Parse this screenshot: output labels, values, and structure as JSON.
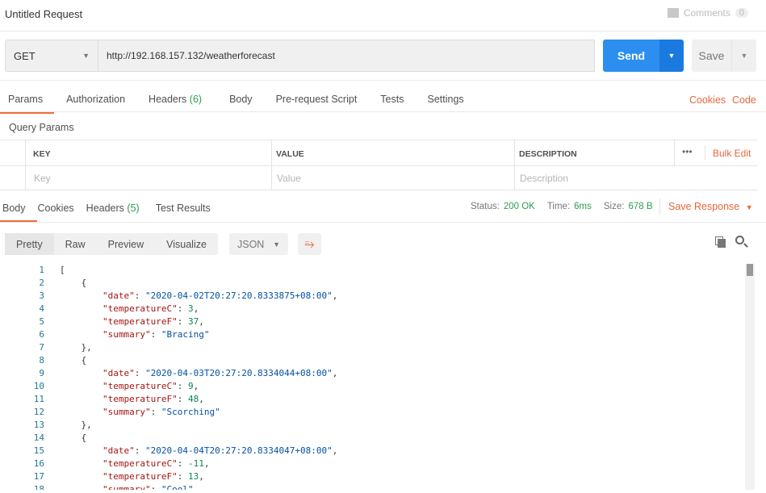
{
  "title": "Untitled Request",
  "comments": {
    "label": "Comments",
    "count": "0"
  },
  "request": {
    "method": "GET",
    "url": "http://192.168.157.132/weatherforecast",
    "send": "Send",
    "save": "Save"
  },
  "req_tabs": [
    {
      "label": "Params"
    },
    {
      "label": "Authorization"
    },
    {
      "label": "Headers",
      "count": "(6)"
    },
    {
      "label": "Body"
    },
    {
      "label": "Pre-request Script"
    },
    {
      "label": "Tests"
    },
    {
      "label": "Settings"
    }
  ],
  "links": {
    "cookies": "Cookies",
    "code": "Code"
  },
  "query": {
    "title": "Query Params",
    "headers": [
      "KEY",
      "VALUE",
      "DESCRIPTION"
    ],
    "placeholders": [
      "Key",
      "Value",
      "Description"
    ],
    "more": "•••",
    "bulk": "Bulk Edit"
  },
  "res_tabs": [
    {
      "label": "Body"
    },
    {
      "label": "Cookies"
    },
    {
      "label": "Headers",
      "count": "(5)"
    },
    {
      "label": "Test Results"
    }
  ],
  "status": {
    "status_label": "Status:",
    "status": "200 OK",
    "time_label": "Time:",
    "time": "6ms",
    "size_label": "Size:",
    "size": "678 B",
    "save_response": "Save Response"
  },
  "formats": [
    "Pretty",
    "Raw",
    "Preview",
    "Visualize"
  ],
  "language": "JSON",
  "code_lines": [
    [
      [
        "p",
        "["
      ]
    ],
    [
      [
        "p",
        "    {"
      ]
    ],
    [
      [
        "p",
        "        "
      ],
      [
        "k",
        "\"date\""
      ],
      [
        "p",
        ": "
      ],
      [
        "s",
        "\"2020-04-02T20:27:20.8333875+08:00\""
      ],
      [
        "p",
        ","
      ]
    ],
    [
      [
        "p",
        "        "
      ],
      [
        "k",
        "\"temperatureC\""
      ],
      [
        "p",
        ": "
      ],
      [
        "n",
        "3"
      ],
      [
        "p",
        ","
      ]
    ],
    [
      [
        "p",
        "        "
      ],
      [
        "k",
        "\"temperatureF\""
      ],
      [
        "p",
        ": "
      ],
      [
        "n",
        "37"
      ],
      [
        "p",
        ","
      ]
    ],
    [
      [
        "p",
        "        "
      ],
      [
        "k",
        "\"summary\""
      ],
      [
        "p",
        ": "
      ],
      [
        "s",
        "\"Bracing\""
      ]
    ],
    [
      [
        "p",
        "    },"
      ]
    ],
    [
      [
        "p",
        "    {"
      ]
    ],
    [
      [
        "p",
        "        "
      ],
      [
        "k",
        "\"date\""
      ],
      [
        "p",
        ": "
      ],
      [
        "s",
        "\"2020-04-03T20:27:20.8334044+08:00\""
      ],
      [
        "p",
        ","
      ]
    ],
    [
      [
        "p",
        "        "
      ],
      [
        "k",
        "\"temperatureC\""
      ],
      [
        "p",
        ": "
      ],
      [
        "n",
        "9"
      ],
      [
        "p",
        ","
      ]
    ],
    [
      [
        "p",
        "        "
      ],
      [
        "k",
        "\"temperatureF\""
      ],
      [
        "p",
        ": "
      ],
      [
        "n",
        "48"
      ],
      [
        "p",
        ","
      ]
    ],
    [
      [
        "p",
        "        "
      ],
      [
        "k",
        "\"summary\""
      ],
      [
        "p",
        ": "
      ],
      [
        "s",
        "\"Scorching\""
      ]
    ],
    [
      [
        "p",
        "    },"
      ]
    ],
    [
      [
        "p",
        "    {"
      ]
    ],
    [
      [
        "p",
        "        "
      ],
      [
        "k",
        "\"date\""
      ],
      [
        "p",
        ": "
      ],
      [
        "s",
        "\"2020-04-04T20:27:20.8334047+08:00\""
      ],
      [
        "p",
        ","
      ]
    ],
    [
      [
        "p",
        "        "
      ],
      [
        "k",
        "\"temperatureC\""
      ],
      [
        "p",
        ": "
      ],
      [
        "n",
        "-11"
      ],
      [
        "p",
        ","
      ]
    ],
    [
      [
        "p",
        "        "
      ],
      [
        "k",
        "\"temperatureF\""
      ],
      [
        "p",
        ": "
      ],
      [
        "n",
        "13"
      ],
      [
        "p",
        ","
      ]
    ],
    [
      [
        "p",
        "        "
      ],
      [
        "k",
        "\"summary\""
      ],
      [
        "p",
        ": "
      ],
      [
        "s",
        "\"Cool\""
      ]
    ]
  ]
}
